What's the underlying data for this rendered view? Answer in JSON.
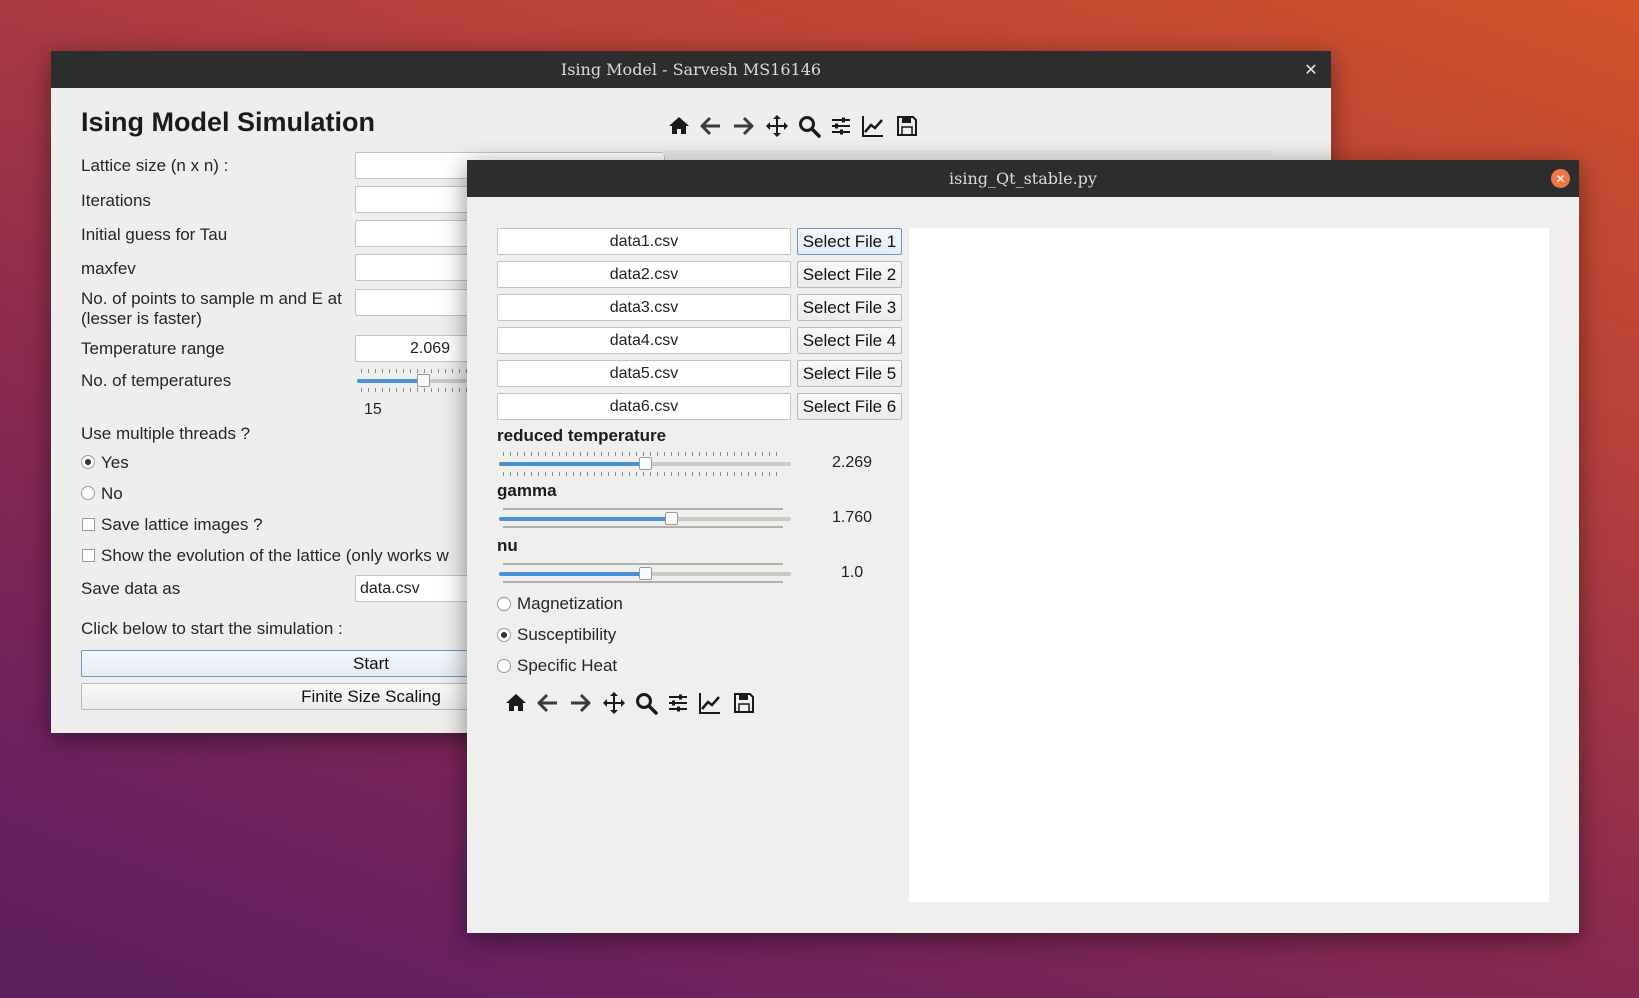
{
  "back_window": {
    "title": "Ising Model - Sarvesh MS16146",
    "heading": "Ising Model Simulation",
    "labels": {
      "lattice": "Lattice size (n x n) :",
      "iterations": "Iterations",
      "tau": "Initial guess for Tau",
      "maxfev": "maxfev",
      "sample_line1": "No. of points to sample m and E at",
      "sample_line2": "(lesser is faster)",
      "temp_range": "Temperature range",
      "num_temps": "No. of temperatures",
      "threads": "Use multiple threads ?",
      "yes": "Yes",
      "no": "No",
      "save_images": "Save lattice images ?",
      "show_evolution": "Show the evolution of the lattice (only works w",
      "save_data": "Save data as",
      "click_below": "Click below to start the simulation :"
    },
    "fields": {
      "lattice": "",
      "iterations": "",
      "tau": "",
      "maxfev": "",
      "sample_points": "",
      "temp_range": "2.069",
      "save_data": "data.csv"
    },
    "num_temps_value": "15",
    "num_temps_fraction": 0.6,
    "threads_selected": "yes",
    "buttons": {
      "start": "Start",
      "finite_size": "Finite Size Scaling"
    },
    "toolbar": [
      "home-icon",
      "back-arrow-icon",
      "forward-arrow-icon",
      "pan-icon",
      "zoom-icon",
      "configure-subplots-icon",
      "edit-axis-icon",
      "save-icon"
    ]
  },
  "front_window": {
    "title": "ising_Qt_stable.py",
    "files": [
      {
        "name": "data1.csv",
        "button": "Select File 1"
      },
      {
        "name": "data2.csv",
        "button": "Select File 2"
      },
      {
        "name": "data3.csv",
        "button": "Select File 3"
      },
      {
        "name": "data4.csv",
        "button": "Select File 4"
      },
      {
        "name": "data5.csv",
        "button": "Select File 5"
      },
      {
        "name": "data6.csv",
        "button": "Select File 6"
      }
    ],
    "sliders": {
      "temperature": {
        "label": "reduced temperature",
        "value": "2.269",
        "fraction": 0.5
      },
      "gamma": {
        "label": "gamma",
        "value": "1.760",
        "fraction": 0.59
      },
      "nu": {
        "label": "nu",
        "value": "1.0",
        "fraction": 0.5
      }
    },
    "plot_options": {
      "magnetization": "Magnetization",
      "susceptibility": "Susceptibility",
      "specific_heat": "Specific Heat",
      "selected": "susceptibility"
    },
    "toolbar": [
      "home-icon",
      "back-arrow-icon",
      "forward-arrow-icon",
      "pan-icon",
      "zoom-icon",
      "configure-subplots-icon",
      "edit-axis-icon",
      "save-icon"
    ]
  }
}
